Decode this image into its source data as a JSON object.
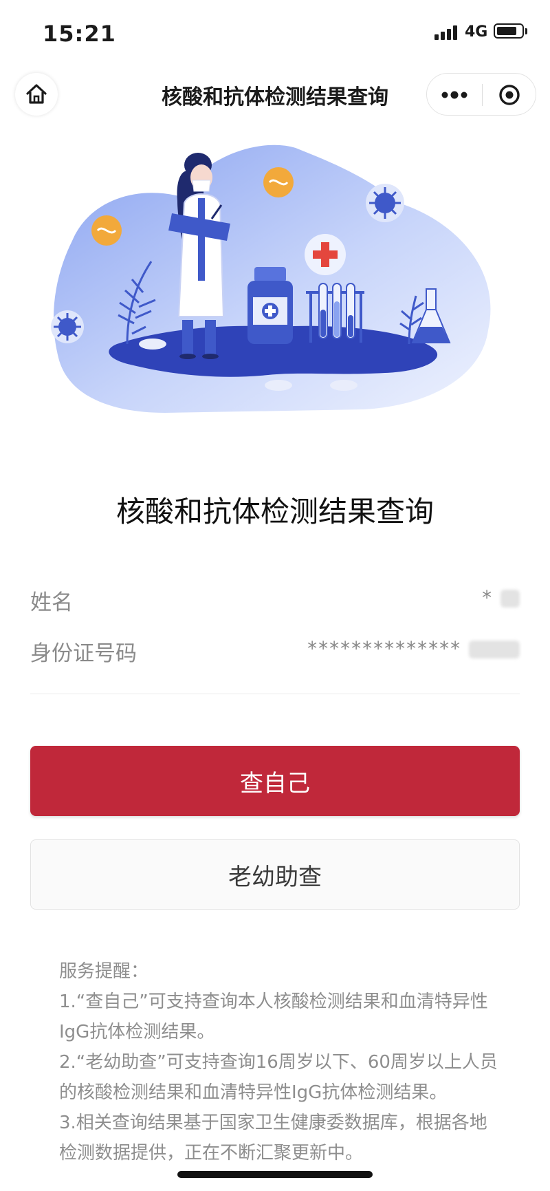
{
  "status_bar": {
    "time": "15:21",
    "network": "4G"
  },
  "nav": {
    "title": "核酸和抗体检测结果查询",
    "home_icon": "home-icon",
    "more_icon": "more-dots-icon",
    "close_icon": "target-close-icon"
  },
  "illustration": {
    "alt_icon": "doctor-medical-illustration"
  },
  "main": {
    "heading": "核酸和抗体检测结果查询"
  },
  "form": {
    "name_label": "姓名",
    "name_value": "*",
    "id_label": "身份证号码",
    "id_value": "**************"
  },
  "buttons": {
    "self_query": "查自己",
    "assist_query": "老幼助查"
  },
  "notice": {
    "title": "服务提醒：",
    "items": [
      "1.“查自己”可支持查询本人核酸检测结果和血清特异性IgG抗体检测结果。",
      "2.“老幼助查”可支持查询16周岁以下、60周岁以上人员的核酸检测结果和血清特异性IgG抗体检测结果。",
      "3.相关查询结果基于国家卫生健康委数据库，根据各地检测数据提供，正在不断汇聚更新中。"
    ]
  },
  "colors": {
    "primary": "#c0283a",
    "illustration_blue": "#3f59c9",
    "accent_red": "#e4463d",
    "accent_orange": "#f2a93b"
  }
}
